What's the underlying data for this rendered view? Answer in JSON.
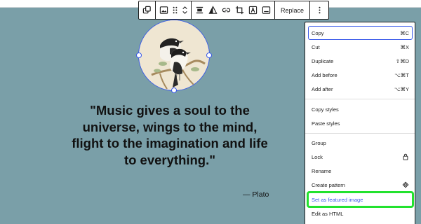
{
  "toolbar": {
    "replace_label": "Replace"
  },
  "quote": {
    "line1": "\"Music gives a soul to the",
    "line2": "universe, wings to the mind,",
    "line3": "flight to the imagination and life",
    "line4": "to everything.\"",
    "citation": "— Plato"
  },
  "menu": {
    "copy": {
      "label": "Copy",
      "shortcut": "⌘C"
    },
    "cut": {
      "label": "Cut",
      "shortcut": "⌘X"
    },
    "duplicate": {
      "label": "Duplicate",
      "shortcut": "⇧⌘D"
    },
    "add_before": {
      "label": "Add before",
      "shortcut": "⌥⌘T"
    },
    "add_after": {
      "label": "Add after",
      "shortcut": "⌥⌘Y"
    },
    "copy_styles": {
      "label": "Copy styles"
    },
    "paste_styles": {
      "label": "Paste styles"
    },
    "group": {
      "label": "Group"
    },
    "lock": {
      "label": "Lock",
      "icon": "lock-icon"
    },
    "rename": {
      "label": "Rename"
    },
    "create_pattern": {
      "label": "Create pattern",
      "icon": "pattern-icon"
    },
    "set_featured": {
      "label": "Set as featured image"
    },
    "edit_html": {
      "label": "Edit as HTML"
    }
  },
  "colors": {
    "canvas": "#7a9fa8",
    "accent": "#3858e9",
    "highlight": "#22e22e"
  }
}
